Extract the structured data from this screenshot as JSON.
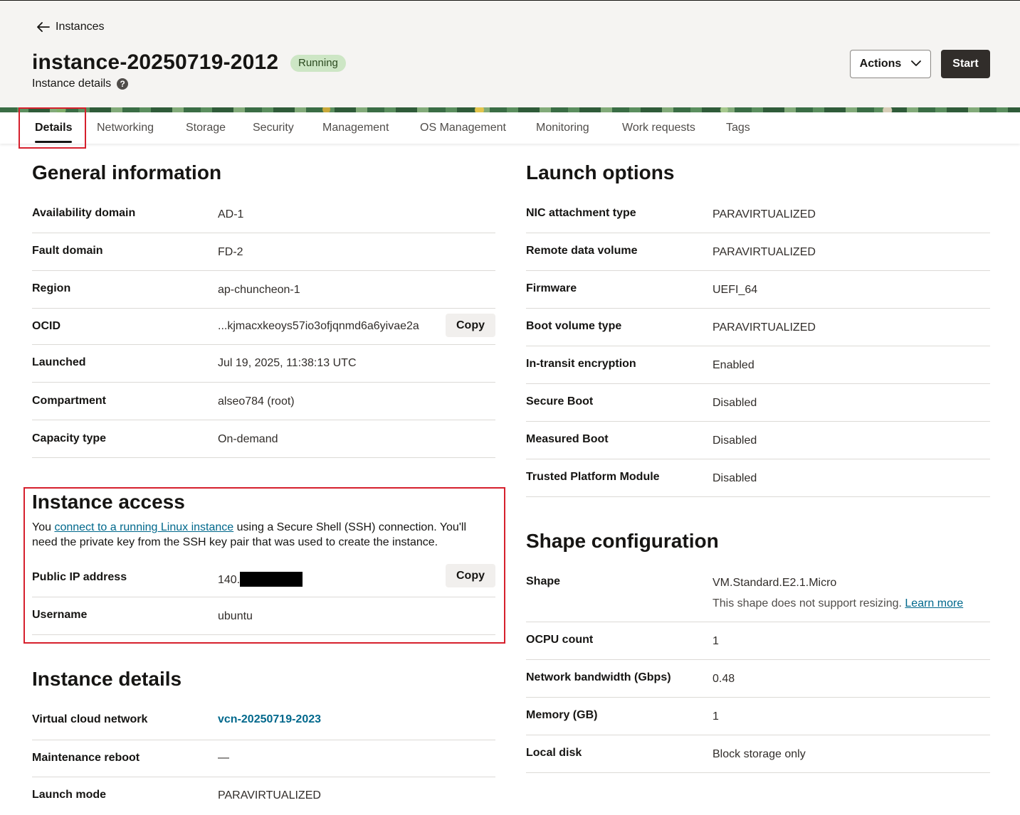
{
  "header": {
    "back_label": "Instances",
    "title": "instance-20250719-2012",
    "status": "Running",
    "subtitle": "Instance details",
    "actions_label": "Actions",
    "start_label": "Start"
  },
  "tabs": [
    "Details",
    "Networking",
    "Storage",
    "Security",
    "Management",
    "OS Management",
    "Monitoring",
    "Work requests",
    "Tags"
  ],
  "general": {
    "title": "General information",
    "rows": [
      {
        "label": "Availability domain",
        "value": "AD-1"
      },
      {
        "label": "Fault domain",
        "value": "FD-2"
      },
      {
        "label": "Region",
        "value": "ap-chuncheon-1"
      },
      {
        "label": "OCID",
        "value": "...kjmacxkeoys57io3ofjqnmd6a6yivae2a",
        "action": "Copy"
      },
      {
        "label": "Launched",
        "value": "Jul 19, 2025, 11:38:13 UTC"
      },
      {
        "label": "Compartment",
        "value": "alseo784 (root)"
      },
      {
        "label": "Capacity type",
        "value": "On-demand"
      }
    ]
  },
  "access": {
    "title": "Instance access",
    "intro_pre": "You ",
    "intro_link": "connect to a running Linux instance",
    "intro_post": " using a Secure Shell (SSH) connection. You'll need the private key from the SSH key pair that was used to create the instance.",
    "rows": [
      {
        "label": "Public IP address",
        "value": "140.",
        "action": "Copy"
      },
      {
        "label": "Username",
        "value": "ubuntu"
      }
    ]
  },
  "details": {
    "title": "Instance details",
    "rows": [
      {
        "label": "Virtual cloud network",
        "value": "vcn-20250719-2023"
      },
      {
        "label": "Maintenance reboot",
        "value": "—"
      },
      {
        "label": "Launch mode",
        "value": "PARAVIRTUALIZED"
      }
    ]
  },
  "launch": {
    "title": "Launch options",
    "rows": [
      {
        "label": "NIC attachment type",
        "value": "PARAVIRTUALIZED"
      },
      {
        "label": "Remote data volume",
        "value": "PARAVIRTUALIZED"
      },
      {
        "label": "Firmware",
        "value": "UEFI_64"
      },
      {
        "label": "Boot volume type",
        "value": "PARAVIRTUALIZED"
      },
      {
        "label": "In-transit encryption",
        "value": "Enabled"
      },
      {
        "label": "Secure Boot",
        "value": "Disabled"
      },
      {
        "label": "Measured Boot",
        "value": "Disabled"
      },
      {
        "label": "Trusted Platform Module",
        "value": "Disabled"
      }
    ]
  },
  "shape": {
    "title": "Shape configuration",
    "rows": [
      {
        "label": "Shape",
        "value": "VM.Standard.E2.1.Micro",
        "note": "This shape does not support resizing.",
        "note_link": "Learn more"
      },
      {
        "label": "OCPU count",
        "value": "1"
      },
      {
        "label": "Network bandwidth (Gbps)",
        "value": "0.48"
      },
      {
        "label": "Memory (GB)",
        "value": "1"
      },
      {
        "label": "Local disk",
        "value": "Block storage only"
      }
    ]
  }
}
